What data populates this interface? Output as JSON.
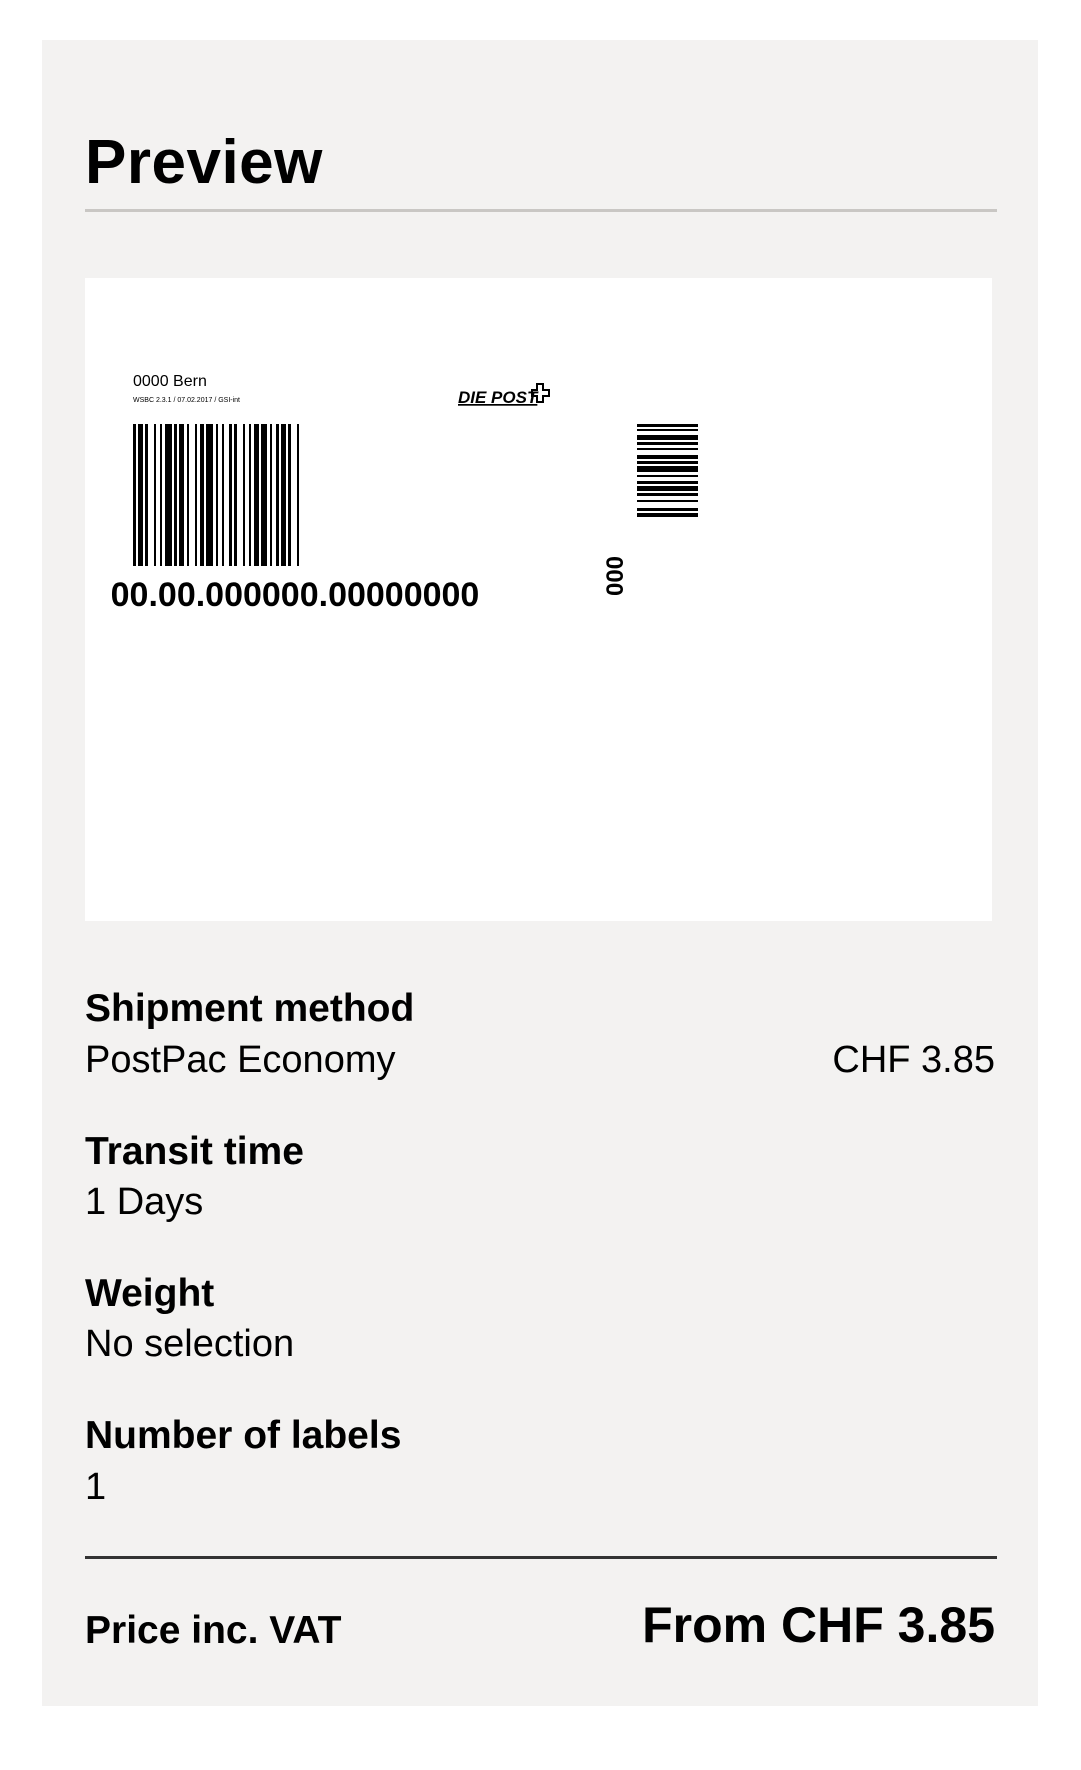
{
  "preview": {
    "title": "Preview"
  },
  "label": {
    "location": "0000 Bern",
    "version_line": "WSBC 2.3.1 / 07.02.2017 / GSI-int",
    "logo_text": "DIE POST",
    "tracking_number": "00.00.000000.00000000",
    "side_code": "000",
    "logo_icon": "swiss-cross-icon"
  },
  "details": {
    "shipment_method": {
      "title": "Shipment method",
      "value": "PostPac Economy",
      "price": "CHF 3.85"
    },
    "transit_time": {
      "title": "Transit time",
      "value": "1 Days"
    },
    "weight": {
      "title": "Weight",
      "value": "No selection"
    },
    "number_of_labels": {
      "title": "Number of labels",
      "value": "1"
    }
  },
  "total": {
    "label": "Price inc. VAT",
    "value": "From CHF 3.85"
  },
  "colors": {
    "panel_background": "#f3f2f1",
    "label_background": "#ffffff",
    "text": "#000000",
    "divider_light": "#c9c7c4",
    "divider_dark": "#333333"
  }
}
